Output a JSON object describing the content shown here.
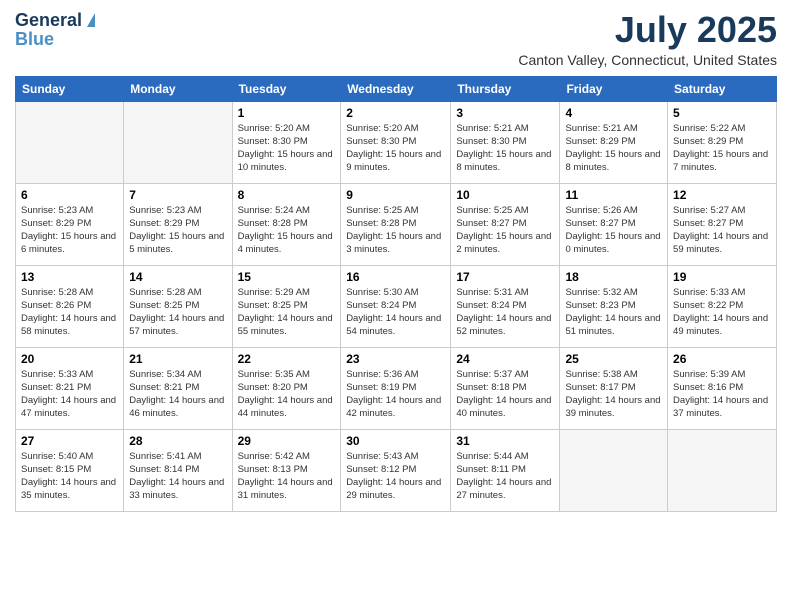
{
  "header": {
    "logo_line1": "General",
    "logo_line2": "Blue",
    "month_title": "July 2025",
    "location": "Canton Valley, Connecticut, United States"
  },
  "weekdays": [
    "Sunday",
    "Monday",
    "Tuesday",
    "Wednesday",
    "Thursday",
    "Friday",
    "Saturday"
  ],
  "weeks": [
    [
      {
        "day": "",
        "sunrise": "",
        "sunset": "",
        "daylight": ""
      },
      {
        "day": "",
        "sunrise": "",
        "sunset": "",
        "daylight": ""
      },
      {
        "day": "1",
        "sunrise": "Sunrise: 5:20 AM",
        "sunset": "Sunset: 8:30 PM",
        "daylight": "Daylight: 15 hours and 10 minutes."
      },
      {
        "day": "2",
        "sunrise": "Sunrise: 5:20 AM",
        "sunset": "Sunset: 8:30 PM",
        "daylight": "Daylight: 15 hours and 9 minutes."
      },
      {
        "day": "3",
        "sunrise": "Sunrise: 5:21 AM",
        "sunset": "Sunset: 8:30 PM",
        "daylight": "Daylight: 15 hours and 8 minutes."
      },
      {
        "day": "4",
        "sunrise": "Sunrise: 5:21 AM",
        "sunset": "Sunset: 8:29 PM",
        "daylight": "Daylight: 15 hours and 8 minutes."
      },
      {
        "day": "5",
        "sunrise": "Sunrise: 5:22 AM",
        "sunset": "Sunset: 8:29 PM",
        "daylight": "Daylight: 15 hours and 7 minutes."
      }
    ],
    [
      {
        "day": "6",
        "sunrise": "Sunrise: 5:23 AM",
        "sunset": "Sunset: 8:29 PM",
        "daylight": "Daylight: 15 hours and 6 minutes."
      },
      {
        "day": "7",
        "sunrise": "Sunrise: 5:23 AM",
        "sunset": "Sunset: 8:29 PM",
        "daylight": "Daylight: 15 hours and 5 minutes."
      },
      {
        "day": "8",
        "sunrise": "Sunrise: 5:24 AM",
        "sunset": "Sunset: 8:28 PM",
        "daylight": "Daylight: 15 hours and 4 minutes."
      },
      {
        "day": "9",
        "sunrise": "Sunrise: 5:25 AM",
        "sunset": "Sunset: 8:28 PM",
        "daylight": "Daylight: 15 hours and 3 minutes."
      },
      {
        "day": "10",
        "sunrise": "Sunrise: 5:25 AM",
        "sunset": "Sunset: 8:27 PM",
        "daylight": "Daylight: 15 hours and 2 minutes."
      },
      {
        "day": "11",
        "sunrise": "Sunrise: 5:26 AM",
        "sunset": "Sunset: 8:27 PM",
        "daylight": "Daylight: 15 hours and 0 minutes."
      },
      {
        "day": "12",
        "sunrise": "Sunrise: 5:27 AM",
        "sunset": "Sunset: 8:27 PM",
        "daylight": "Daylight: 14 hours and 59 minutes."
      }
    ],
    [
      {
        "day": "13",
        "sunrise": "Sunrise: 5:28 AM",
        "sunset": "Sunset: 8:26 PM",
        "daylight": "Daylight: 14 hours and 58 minutes."
      },
      {
        "day": "14",
        "sunrise": "Sunrise: 5:28 AM",
        "sunset": "Sunset: 8:25 PM",
        "daylight": "Daylight: 14 hours and 57 minutes."
      },
      {
        "day": "15",
        "sunrise": "Sunrise: 5:29 AM",
        "sunset": "Sunset: 8:25 PM",
        "daylight": "Daylight: 14 hours and 55 minutes."
      },
      {
        "day": "16",
        "sunrise": "Sunrise: 5:30 AM",
        "sunset": "Sunset: 8:24 PM",
        "daylight": "Daylight: 14 hours and 54 minutes."
      },
      {
        "day": "17",
        "sunrise": "Sunrise: 5:31 AM",
        "sunset": "Sunset: 8:24 PM",
        "daylight": "Daylight: 14 hours and 52 minutes."
      },
      {
        "day": "18",
        "sunrise": "Sunrise: 5:32 AM",
        "sunset": "Sunset: 8:23 PM",
        "daylight": "Daylight: 14 hours and 51 minutes."
      },
      {
        "day": "19",
        "sunrise": "Sunrise: 5:33 AM",
        "sunset": "Sunset: 8:22 PM",
        "daylight": "Daylight: 14 hours and 49 minutes."
      }
    ],
    [
      {
        "day": "20",
        "sunrise": "Sunrise: 5:33 AM",
        "sunset": "Sunset: 8:21 PM",
        "daylight": "Daylight: 14 hours and 47 minutes."
      },
      {
        "day": "21",
        "sunrise": "Sunrise: 5:34 AM",
        "sunset": "Sunset: 8:21 PM",
        "daylight": "Daylight: 14 hours and 46 minutes."
      },
      {
        "day": "22",
        "sunrise": "Sunrise: 5:35 AM",
        "sunset": "Sunset: 8:20 PM",
        "daylight": "Daylight: 14 hours and 44 minutes."
      },
      {
        "day": "23",
        "sunrise": "Sunrise: 5:36 AM",
        "sunset": "Sunset: 8:19 PM",
        "daylight": "Daylight: 14 hours and 42 minutes."
      },
      {
        "day": "24",
        "sunrise": "Sunrise: 5:37 AM",
        "sunset": "Sunset: 8:18 PM",
        "daylight": "Daylight: 14 hours and 40 minutes."
      },
      {
        "day": "25",
        "sunrise": "Sunrise: 5:38 AM",
        "sunset": "Sunset: 8:17 PM",
        "daylight": "Daylight: 14 hours and 39 minutes."
      },
      {
        "day": "26",
        "sunrise": "Sunrise: 5:39 AM",
        "sunset": "Sunset: 8:16 PM",
        "daylight": "Daylight: 14 hours and 37 minutes."
      }
    ],
    [
      {
        "day": "27",
        "sunrise": "Sunrise: 5:40 AM",
        "sunset": "Sunset: 8:15 PM",
        "daylight": "Daylight: 14 hours and 35 minutes."
      },
      {
        "day": "28",
        "sunrise": "Sunrise: 5:41 AM",
        "sunset": "Sunset: 8:14 PM",
        "daylight": "Daylight: 14 hours and 33 minutes."
      },
      {
        "day": "29",
        "sunrise": "Sunrise: 5:42 AM",
        "sunset": "Sunset: 8:13 PM",
        "daylight": "Daylight: 14 hours and 31 minutes."
      },
      {
        "day": "30",
        "sunrise": "Sunrise: 5:43 AM",
        "sunset": "Sunset: 8:12 PM",
        "daylight": "Daylight: 14 hours and 29 minutes."
      },
      {
        "day": "31",
        "sunrise": "Sunrise: 5:44 AM",
        "sunset": "Sunset: 8:11 PM",
        "daylight": "Daylight: 14 hours and 27 minutes."
      },
      {
        "day": "",
        "sunrise": "",
        "sunset": "",
        "daylight": ""
      },
      {
        "day": "",
        "sunrise": "",
        "sunset": "",
        "daylight": ""
      }
    ]
  ]
}
